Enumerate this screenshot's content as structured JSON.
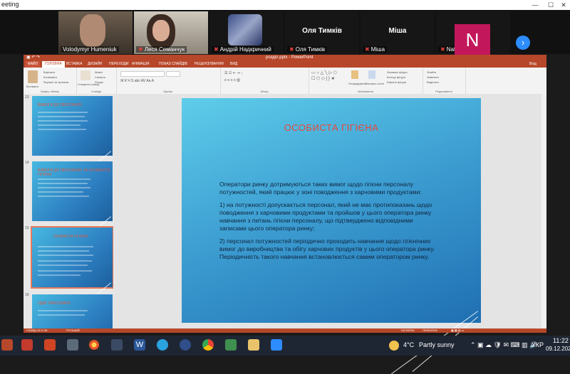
{
  "window": {
    "title": "eeting"
  },
  "participants": [
    {
      "name": "Volodymyr Humeniuk",
      "muted": false
    },
    {
      "name": "Леся Семанчук",
      "muted": true
    },
    {
      "name": "Андрій Надкричний",
      "muted": true
    },
    {
      "name": "Оля Тимків",
      "muted": true
    },
    {
      "name": "Міша",
      "muted": true
    },
    {
      "name": "Natalia Kazuta",
      "muted": true,
      "avatar_letter": "N"
    }
  ],
  "big_names": [
    "Оля Тимків",
    "Міша"
  ],
  "powerpoint": {
    "filename": "розділ.pptx - PowerPoint",
    "tabs": [
      "ФАЙЛ",
      "ГОЛОВНА",
      "ВСТАВКА",
      "ДИЗАЙН",
      "ПЕРЕХОДИ",
      "АНІМАЦІЯ",
      "ПОКАЗ СЛАЙДІВ",
      "РЕЦЕНЗУВАННЯ",
      "ВИД"
    ],
    "user": "Вхід",
    "ribbon_groups": [
      "Буфер обміну",
      "Слайди",
      "Шрифт",
      "Абзац",
      "Малювання",
      "Редагування"
    ],
    "ribbon_items": {
      "paste": "Вставити",
      "cut": "Вирізати",
      "copy": "Копіювати",
      "format_painter": "Формат за зразком",
      "new_slide": "Створити слайд",
      "layout": "Макет",
      "reset": "Скинути",
      "section": "Розділ",
      "find": "Знайти",
      "replace": "Замінити",
      "select": "Виділити",
      "arrange": "Упорядкувати",
      "quick_styles": "Експрес-стилі",
      "fill": "Заливка фігури",
      "outline": "Контур фігури",
      "effects": "Ефекти фігури"
    },
    "thumbnails": [
      {
        "number": "13",
        "title": "ВИМОГИ ДО ПЕРСОНАЛУ"
      },
      {
        "number": "14",
        "title": "ВИМОГИ ДО ПЕРСОНАЛУ ТА ОСОБИСТОЇ ГІГІЄНИ"
      },
      {
        "number": "15",
        "title": "ОСОБИСТА ГІГІЄНА",
        "selected": true
      },
      {
        "number": "16",
        "title": "ОДЯГ ПЕРСОНАЛУ"
      }
    ],
    "slide": {
      "title": "ОСОБИСТА ГІГІЄНА",
      "paragraphs": [
        "Оператори ринку дотримуються таких вимог щодо гігієни персоналу потужностей, який працює у зоні поводження з харчовими продуктами:",
        "1) на потужності допускається персонал, який не має протипоказань щодо поводження з харчовими продуктами та пройшов у цього оператора ринку навчання з питань гігієни персоналу, що підтверджено відповідними записами цього оператора ринку;",
        "2) персонал потужностей періодично проходить навчання щодо гігієнічних вимог до виробництва та обігу харчових продуктів у цього оператора ринку. Періодичність такого навчання встановлюється самим оператором ринку."
      ]
    },
    "status_left": "СЛАЙД 15 ІЗ 35",
    "status_lang": "РУСЬКИЙ",
    "status_notes": "НОТАТКИ",
    "status_comments": "ПРИМІТКИ"
  },
  "taskbar": {
    "weather_temp": "4°C",
    "weather_text": "Partly sunny",
    "lang": "УКР",
    "time": "11:22",
    "date": "09.12.202"
  },
  "colors": {
    "ppt_red": "#b7472a",
    "slide_title": "#e8473a",
    "zoom_blue": "#2d8cff",
    "avatar_pink": "#c2185b"
  }
}
